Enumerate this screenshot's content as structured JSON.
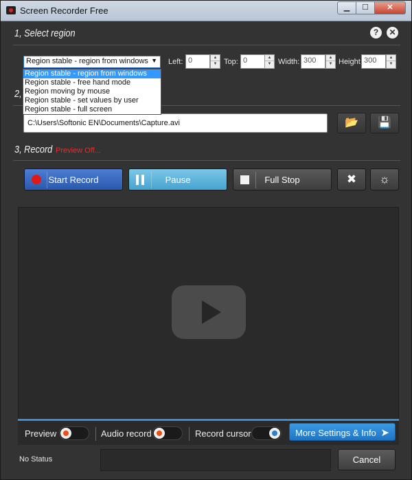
{
  "window": {
    "title": "Screen Recorder Free",
    "min": "▁",
    "max": "☐",
    "close": "✕"
  },
  "section1": {
    "title": "1, Select region",
    "help": "?",
    "close": "✕"
  },
  "region": {
    "selected": "Region stable - region from windows",
    "options": [
      "Region stable - region from windows",
      "Region stable - free hand mode",
      "Region moving by mouse",
      "Region stable - set values by user",
      "Region stable - full screen"
    ],
    "left_label": "Left:",
    "left_value": "0",
    "top_label": "Top:",
    "top_value": "0",
    "width_label": "Width:",
    "width_value": "300",
    "height_label": "Height",
    "height_value": "300"
  },
  "section2": {
    "title": "2,",
    "path": "C:\\Users\\Softonic EN\\Documents\\Capture.avi"
  },
  "section3": {
    "title": "3, Record",
    "preview_status": "Preview Off..."
  },
  "buttons": {
    "start": "Start Record",
    "pause": "Pause",
    "stop": "Full Stop"
  },
  "options": {
    "preview": "Preview",
    "audio": "Audio record",
    "cursor": "Record cursor",
    "more": "More Settings & Info"
  },
  "footer": {
    "status": "No Status",
    "cancel": "Cancel"
  },
  "colors": {
    "accent": "#3a8fd6",
    "record": "#e01818",
    "preview_off": "#e03030"
  }
}
